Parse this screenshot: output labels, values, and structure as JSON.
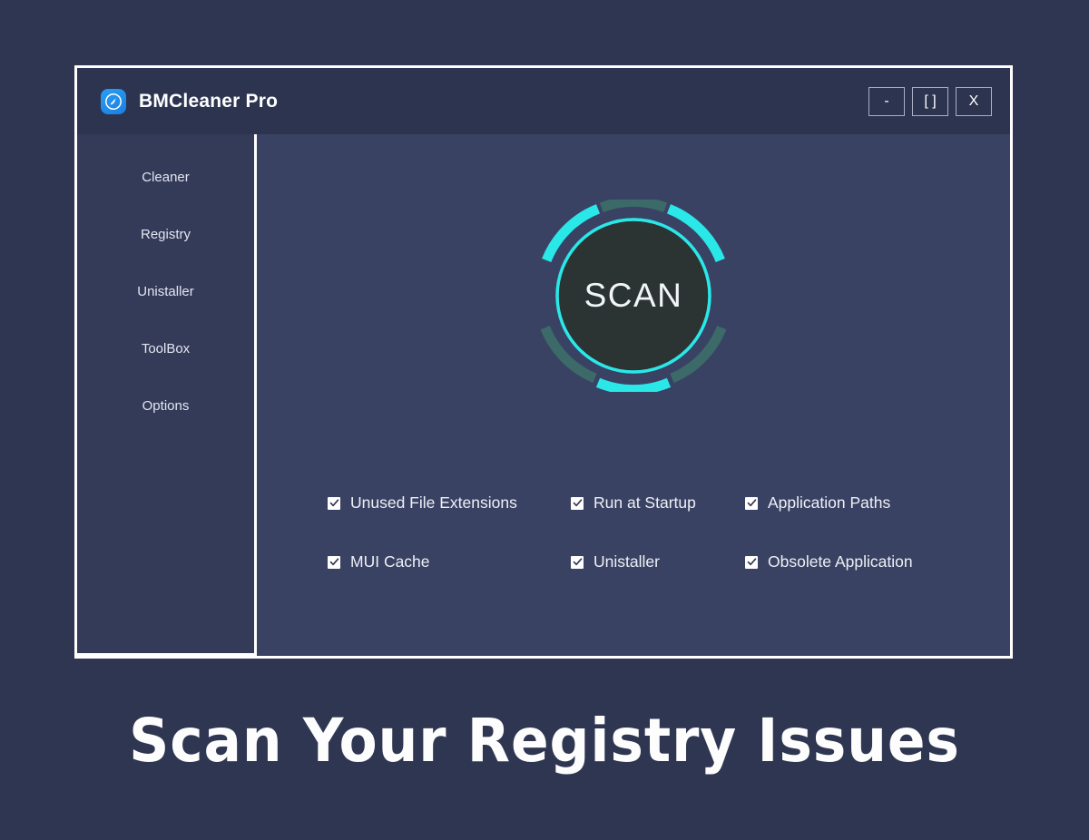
{
  "window": {
    "title": "BMCleaner Pro",
    "icon": "broom-app-icon",
    "controls": [
      {
        "name": "minimize",
        "label": "-"
      },
      {
        "name": "maximize",
        "label": "[ ]"
      },
      {
        "name": "close",
        "label": "X"
      }
    ]
  },
  "sidebar": {
    "items": [
      {
        "label": "Cleaner"
      },
      {
        "label": "Registry"
      },
      {
        "label": "Unistaller"
      },
      {
        "label": "ToolBox"
      },
      {
        "label": "Options"
      }
    ]
  },
  "main": {
    "scan_button": {
      "label": "SCAN"
    },
    "options": [
      {
        "label": "Unused File Extensions",
        "checked": true
      },
      {
        "label": "Run at Startup",
        "checked": true
      },
      {
        "label": "Application Paths",
        "checked": true
      },
      {
        "label": "MUI Cache",
        "checked": true
      },
      {
        "label": "Unistaller",
        "checked": true
      },
      {
        "label": "Obsolete Application",
        "checked": true
      }
    ]
  },
  "caption": {
    "text": "Scan Your Registry Issues"
  },
  "colors": {
    "page_background": "#2e3652",
    "titlebar": "#2c3450",
    "sidebar": "#333b59",
    "content": "#3a4263",
    "window_border": "#ffffff",
    "accent_cyan": "#2ae8e8",
    "accent_teal_dim": "#3c6a68",
    "scan_inner": "#2b3433",
    "icon_blue": "#2b9df4",
    "text_primary": "#ffffff"
  }
}
